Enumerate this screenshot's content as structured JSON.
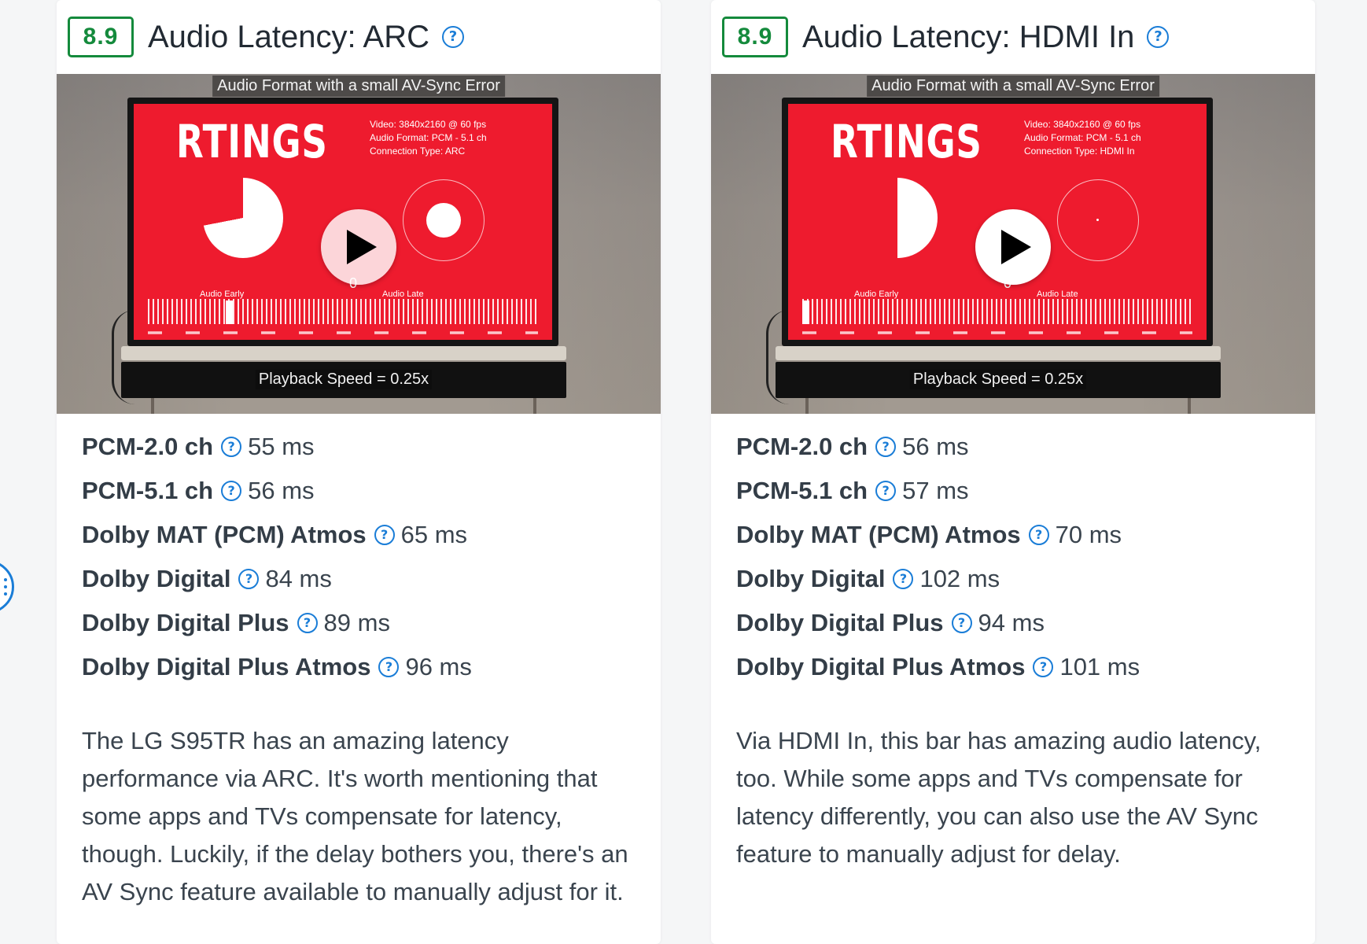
{
  "cards": [
    {
      "score": "8.9",
      "title": "Audio Latency: ARC",
      "media": {
        "caption_top": "Audio Format with a small AV-Sync Error",
        "logo": "RTINGS",
        "info_lines": [
          "Video: 3840x2160 @ 60 fps",
          "Audio Format: PCM - 5.1 ch",
          "Connection Type: ARC"
        ],
        "audio_early": "Audio Early",
        "audio_late": "Audio Late",
        "zero": "0",
        "caption_bottom": "Playback Speed = 0.25x",
        "pie_fraction": 0.72,
        "sync_dot_level": 0.42,
        "ruler_marker_level": 0.2
      },
      "rows": [
        {
          "label": "PCM-2.0 ch",
          "value": "55 ms"
        },
        {
          "label": "PCM-5.1 ch",
          "value": "56 ms"
        },
        {
          "label": "Dolby MAT (PCM) Atmos",
          "value": "65 ms"
        },
        {
          "label": "Dolby Digital",
          "value": "84 ms"
        },
        {
          "label": "Dolby Digital Plus",
          "value": "89 ms"
        },
        {
          "label": "Dolby Digital Plus Atmos",
          "value": "96 ms"
        }
      ],
      "description": "The LG S95TR has an amazing latency performance via ARC. It's worth mentioning that some apps and TVs compensate for latency, though. Luckily, if the delay bothers you, there's an AV Sync feature available to manually adjust for it."
    },
    {
      "score": "8.9",
      "title": "Audio Latency: HDMI In",
      "media": {
        "caption_top": "Audio Format with a small AV-Sync Error",
        "logo": "RTINGS",
        "info_lines": [
          "Video: 3840x2160 @ 60 fps",
          "Audio Format: PCM - 5.1 ch",
          "Connection Type: HDMI In"
        ],
        "audio_early": "Audio Early",
        "audio_late": "Audio Late",
        "zero": "0",
        "caption_bottom": "Playback Speed = 0.25x",
        "pie_fraction": 0.5,
        "sync_dot_level": 0.03,
        "ruler_marker_level": 0.0
      },
      "rows": [
        {
          "label": "PCM-2.0 ch",
          "value": "56 ms"
        },
        {
          "label": "PCM-5.1 ch",
          "value": "57 ms"
        },
        {
          "label": "Dolby MAT (PCM) Atmos",
          "value": "70 ms"
        },
        {
          "label": "Dolby Digital",
          "value": "102 ms"
        },
        {
          "label": "Dolby Digital Plus",
          "value": "94 ms"
        },
        {
          "label": "Dolby Digital Plus Atmos",
          "value": "101 ms"
        }
      ],
      "description": "Via HDMI In, this bar has amazing audio latency, too. While some apps and TVs compensate for latency differently, you can also use the AV Sync feature to manually adjust for delay."
    }
  ],
  "colors": {
    "score_green": "#148a3c",
    "accent_blue": "#1a7dd7",
    "screen_red": "#ee1b2e"
  },
  "icons": {
    "help": "question-circle-icon",
    "play": "play-icon",
    "side_tab": "vertical-dots-icon"
  }
}
